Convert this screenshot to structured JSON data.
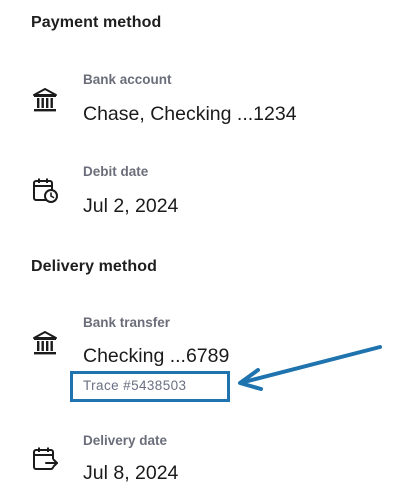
{
  "payment": {
    "title": "Payment method",
    "bank_account": {
      "icon": "bank-icon",
      "label": "Bank account",
      "value": "Chase, Checking ...1234"
    },
    "debit_date": {
      "icon": "calendar-clock-icon",
      "label": "Debit date",
      "value": "Jul 2, 2024"
    }
  },
  "delivery": {
    "title": "Delivery method",
    "bank_transfer": {
      "icon": "bank-icon",
      "label": "Bank transfer",
      "value": "Checking ...6789",
      "trace": "Trace #5438503"
    },
    "delivery_date": {
      "icon": "calendar-arrow-icon",
      "label": "Delivery date",
      "value": "Jul 8, 2024"
    }
  },
  "annotation": {
    "highlight_color": "#1f73ae"
  }
}
